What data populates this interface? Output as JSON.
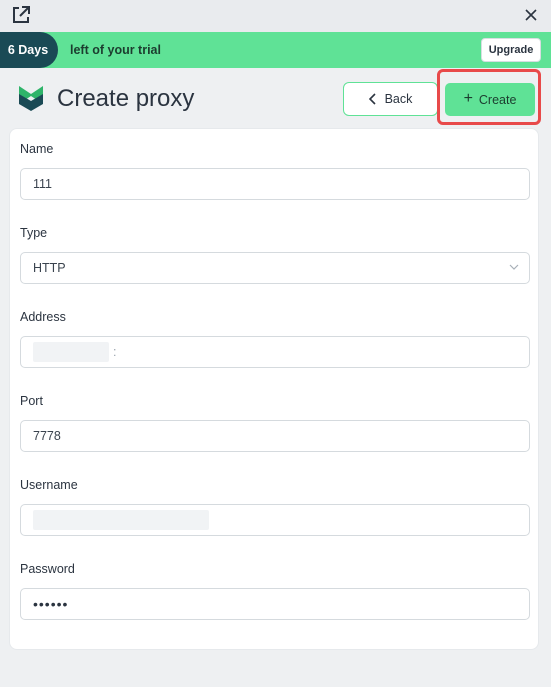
{
  "titlebar": {
    "popout_icon": "external-link-icon",
    "close_icon": "close-icon"
  },
  "trial": {
    "days": "6 Days",
    "message": "left of your trial",
    "upgrade_label": "Upgrade"
  },
  "header": {
    "title": "Create proxy",
    "back_label": "Back",
    "create_label": "Create",
    "create_plus": "+"
  },
  "form": {
    "name": {
      "label": "Name",
      "value": "111"
    },
    "type": {
      "label": "Type",
      "value": "HTTP"
    },
    "address": {
      "label": "Address",
      "separator": ":"
    },
    "port": {
      "label": "Port",
      "value": "7778"
    },
    "username": {
      "label": "Username"
    },
    "password": {
      "label": "Password",
      "value": "••••••"
    }
  },
  "colors": {
    "accent": "#5fe296",
    "dark": "#1a4a55",
    "highlight": "#e84a4a"
  }
}
